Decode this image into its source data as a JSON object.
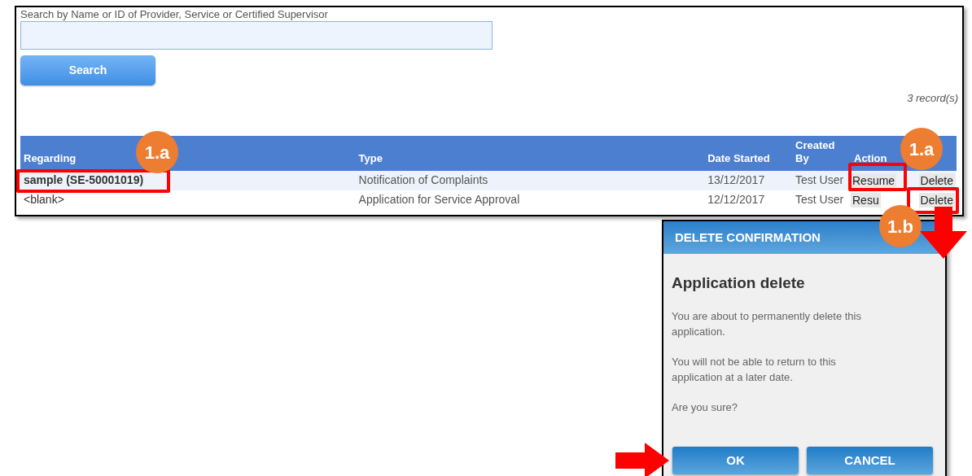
{
  "search": {
    "label": "Search by Name or ID of Provider, Service or Certified Supervisor",
    "button": "Search"
  },
  "record_count": "3 record(s)",
  "table": {
    "columns": [
      "Regarding",
      "Type",
      "Date Started",
      "Created By",
      "Action"
    ],
    "rows": [
      {
        "highlighted": true,
        "regarding": "sample (SE-50001019)",
        "type": "Notification of Complaints",
        "date_started": "13/12/2017",
        "created_by": "Test User",
        "actions": [
          "Resume",
          "Delete"
        ]
      },
      {
        "highlighted": false,
        "regarding": "<blank>",
        "type": "Application for Service Approval",
        "date_started": "12/12/2017",
        "created_by": "Test User",
        "actions": [
          "Resu",
          "Delete"
        ]
      }
    ]
  },
  "dialog": {
    "title": "DELETE CONFIRMATION",
    "heading": "Application delete",
    "paragraphs": [
      "You are about to permanently delete this application.",
      "You will not be able to return to this application at a later date.",
      "Are you sure?"
    ],
    "buttons": [
      "OK",
      "CANCEL"
    ]
  },
  "annotations": {
    "badges": [
      "1.a",
      "1.a",
      "1.b"
    ]
  }
}
